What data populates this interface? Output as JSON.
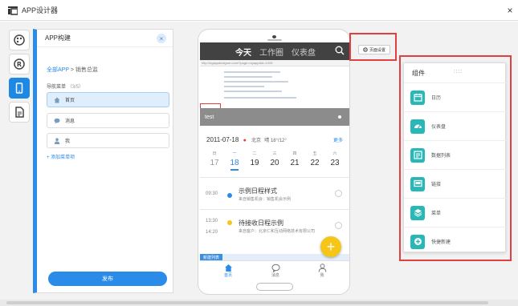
{
  "window": {
    "title": "APP设计器",
    "close_glyph": "×"
  },
  "rail": {
    "icons": [
      "palette-icon",
      "registered-icon",
      "mobile-icon",
      "document-icon"
    ],
    "active_index": 2
  },
  "panel": {
    "title": "APP构建",
    "close_glyph": "×",
    "breadcrumb": {
      "root": "全部APP",
      "sep": ">",
      "current": "销售总监"
    },
    "nav_header": "导航菜单",
    "nav_count": "（3/5）",
    "nav_items": [
      {
        "label": "首页",
        "icon": "home-icon",
        "selected": true
      },
      {
        "label": "消息",
        "icon": "chat-icon",
        "selected": false
      },
      {
        "label": "我",
        "icon": "user-icon",
        "selected": false
      }
    ],
    "add_nav": "+ 添加菜单项",
    "publish": "发布"
  },
  "phone": {
    "tabs": [
      "今天",
      "工作圈",
      "仪表盘"
    ],
    "active_tab": 0,
    "url": "http://ngappdesigner.com/?page=myapp&id=1209",
    "banner_text": "test",
    "date": "2011-07-18",
    "location": "北京",
    "weather": "晴 18°/12°",
    "more": "更多",
    "week": [
      {
        "name": "日",
        "day": "17",
        "grey": true
      },
      {
        "name": "一",
        "day": "18",
        "today": true
      },
      {
        "name": "二",
        "day": "19"
      },
      {
        "name": "三",
        "day": "20"
      },
      {
        "name": "四",
        "day": "21"
      },
      {
        "name": "五",
        "day": "22"
      },
      {
        "name": "六",
        "day": "23"
      }
    ],
    "events": [
      {
        "time": "09:30",
        "end": "",
        "title": "示例日程样式",
        "sub": "来自销售机会：销售机会示例",
        "color": "#2a8be8"
      },
      {
        "time": "13:30",
        "end": "14:20",
        "title": "待接收日程示例",
        "sub": "来自客户：北京仁和互动网络技术有限公司",
        "color": "#f5c518"
      }
    ],
    "band_tag": "新建列表",
    "fab": "+",
    "bottom_tabs": [
      {
        "label": "首页",
        "icon": "home-icon",
        "active": true
      },
      {
        "label": "消息",
        "icon": "chat-icon",
        "active": false
      },
      {
        "label": "我",
        "icon": "user-icon",
        "active": false
      }
    ]
  },
  "page_settings": {
    "label": "页面设置"
  },
  "components": {
    "title": "组件",
    "handle": "::::",
    "items": [
      {
        "label": "日历",
        "icon": "calendar-icon"
      },
      {
        "label": "仪表盘",
        "icon": "gauge-icon"
      },
      {
        "label": "数据列表",
        "icon": "list-icon"
      },
      {
        "label": "链接",
        "icon": "monitor-icon"
      },
      {
        "label": "菜单",
        "icon": "layers-icon"
      },
      {
        "label": "快捷新建",
        "icon": "plus-circle-icon"
      }
    ]
  },
  "colors": {
    "accent": "#2a8be8",
    "teal": "#2ab7b7",
    "alert": "#e04040",
    "fab": "#f5c518"
  }
}
